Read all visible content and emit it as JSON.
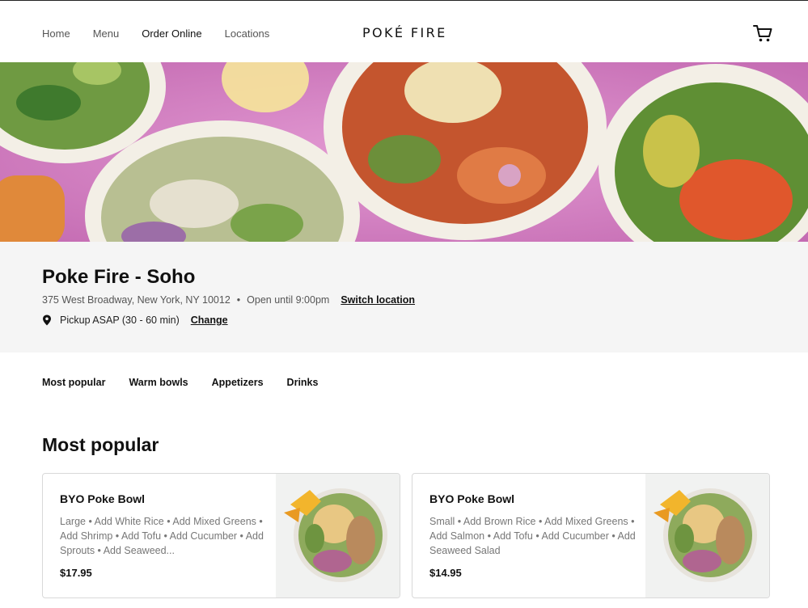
{
  "nav": {
    "items": [
      {
        "label": "Home",
        "active": false
      },
      {
        "label": "Menu",
        "active": false
      },
      {
        "label": "Order Online",
        "active": true
      },
      {
        "label": "Locations",
        "active": false
      }
    ]
  },
  "brand": {
    "logo_text": "POKÉ FIRE"
  },
  "header": {
    "cart_icon": "shopping-cart-icon"
  },
  "store": {
    "name": "Poke Fire - Soho",
    "address": "375 West Broadway, New York, NY 10012",
    "separator": "•",
    "hours": "Open until 9:00pm",
    "switch_label": "Switch location",
    "pickup_icon": "location-pin-icon",
    "pickup_text": "Pickup ASAP (30 - 60 min)",
    "change_label": "Change"
  },
  "tabs": [
    "Most popular",
    "Warm bowls",
    "Appetizers",
    "Drinks"
  ],
  "section": {
    "title": "Most popular"
  },
  "items": [
    {
      "title": "BYO Poke Bowl",
      "description": "Large • Add White Rice • Add Mixed Greens • Add Shrimp • Add Tofu • Add Cucumber • Add Sprouts • Add Seaweed...",
      "price": "$17.95"
    },
    {
      "title": "BYO Poke Bowl",
      "description": "Small • Add Brown Rice • Add Mixed Greens • Add Salmon • Add Tofu • Add Cucumber • Add Seaweed Salad",
      "price": "$14.95"
    }
  ],
  "colors": {
    "hero_background": "#d37fc1",
    "info_background": "#f5f5f5",
    "text": "#111111"
  }
}
